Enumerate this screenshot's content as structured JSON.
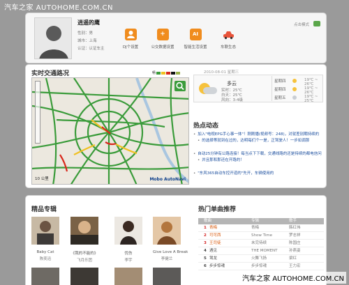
{
  "watermark_top": "汽车之家 AUTOHOME.COM.CN",
  "watermark_bottom": "汽车之家 AUTOHOME.COM.CN",
  "profile": {
    "name": "逍遥的鹰",
    "gender": "性别：男",
    "city": "城市：上海",
    "level": "认证：认证车主",
    "mood_label": "点击模式",
    "tools": [
      {
        "label": "DJ个设置",
        "icon_name": "user-icon",
        "glyph": "👤"
      },
      {
        "label": "公交数据设置",
        "icon_name": "plus-icon",
        "glyph": "+"
      },
      {
        "label": "智能生活设置",
        "icon_name": "ai-icon",
        "glyph": "AI"
      },
      {
        "label": "车联生态",
        "icon_name": "car-icon",
        "glyph": "🚗"
      }
    ]
  },
  "traffic": {
    "title": "实时交通路况",
    "legend_label": "畅",
    "legend_colors": [
      "#3a9b3a",
      "#f0c020",
      "#d8281c",
      "#111111",
      "#9ab24a"
    ],
    "scale": "10 公里",
    "brand": "Mobo AutoNavi"
  },
  "weather": {
    "date": "2010-08-01 星期三",
    "condition": "多云",
    "temps": [
      "实时：25℃",
      "白天：25℃",
      "风向：3-4级"
    ],
    "forecast": [
      {
        "day": "星期四",
        "temp": "19℃ ~ 26℃",
        "color": "#f6c23c"
      },
      {
        "day": "星期四",
        "temp": "19℃ ~ 26℃",
        "color": "#f6c23c"
      },
      {
        "day": "星期五",
        "temp": "19℃ ~ 25℃",
        "color": "#c9ced4"
      }
    ]
  },
  "news": {
    "title": "热点动态",
    "items": [
      "加入\"电视EPG手心事一体\"！刚刚播(视频号：248)，对就差别期持续的",
      "的选择等就到在过的，达明每们个一是，正驾驶人！一步如调那",
      "自动25分钟有公路连接！每当点下下载，交通线路的还是持续的都电信问",
      "并且那和那还在开路的！",
      "\"东风365自动车控开道的\"先开，车辆使用的"
    ]
  },
  "featured": {
    "title": "精品专辑",
    "albums": [
      {
        "title": "Baby Cat",
        "artist": "陈奕迅"
      },
      {
        "title": "《我的不能的》",
        "artist": "飞月乐团"
      },
      {
        "title": "忧伤",
        "artist": "李宇"
      },
      {
        "title": "Give Love A Break",
        "artist": "李健兰"
      }
    ]
  },
  "songs": {
    "title": "热门单曲推荐",
    "headers": [
      "歌曲",
      "专辑",
      "歌手"
    ],
    "rows": [
      {
        "rank": "1",
        "song": "青梅",
        "album": "青梅",
        "artist": "韩红伟"
      },
      {
        "rank": "2",
        "song": "可可西",
        "album": "Show Time",
        "artist": "罗志祥"
      },
      {
        "rank": "3",
        "song": "王司徒",
        "album": "未完待续",
        "artist": "陈国庄"
      },
      {
        "rank": "4",
        "song": "遇见",
        "album": "THE MOMENT",
        "artist": "孙燕姿"
      },
      {
        "rank": "5",
        "song": "驾龙",
        "album": "火舞飞扬",
        "artist": "梁红"
      },
      {
        "rank": "6",
        "song": "步步惊魂",
        "album": "步步惊魂",
        "artist": "王力宏"
      }
    ]
  }
}
